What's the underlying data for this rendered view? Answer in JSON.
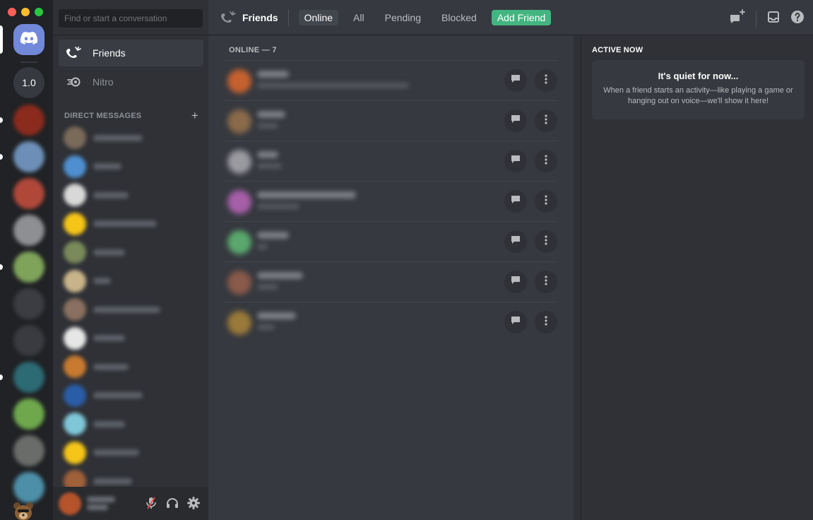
{
  "window": {
    "controls": [
      {
        "name": "close",
        "color": "#ff5f57"
      },
      {
        "name": "minimize",
        "color": "#febc2e"
      },
      {
        "name": "zoom",
        "color": "#28c840"
      }
    ]
  },
  "rail": {
    "home_icon": "discord-logo-icon",
    "version_label": "1.0",
    "servers": [
      {
        "color": "#8a2b1e",
        "unread": true
      },
      {
        "color": "#6d8fb7",
        "unread": true
      },
      {
        "color": "#b0483a",
        "unread": false
      },
      {
        "color": "#8d8f92",
        "unread": false
      },
      {
        "color": "#7fa35a",
        "unread": true
      },
      {
        "color": "#3b3d42",
        "unread": false
      },
      {
        "color": "#393b40",
        "unread": false
      },
      {
        "color": "#2c6a74",
        "unread": true
      },
      {
        "color": "#6fa84c",
        "unread": false
      },
      {
        "color": "#6a6c6a",
        "unread": false
      },
      {
        "color": "#4d8fa8",
        "unread": false
      }
    ]
  },
  "sidebar": {
    "search_placeholder": "Find or start a conversation",
    "nav": [
      {
        "label": "Friends",
        "icon": "friends-wave-icon",
        "active": true
      },
      {
        "label": "Nitro",
        "icon": "nitro-icon",
        "active": false
      }
    ],
    "dm_header": "DIRECT MESSAGES",
    "dm_add": "+",
    "dms": [
      {
        "color": "#7a6a5a"
      },
      {
        "color": "#4f8fd0"
      },
      {
        "color": "#d8d8d8"
      },
      {
        "color": "#f5c518"
      },
      {
        "color": "#7a8a5a"
      },
      {
        "color": "#c9b48a"
      },
      {
        "color": "#8a7060"
      },
      {
        "color": "#e6e6e6"
      },
      {
        "color": "#c77a30"
      },
      {
        "color": "#2a5da8"
      },
      {
        "color": "#7fc7d8"
      },
      {
        "color": "#f5c518"
      },
      {
        "color": "#a0603a"
      }
    ]
  },
  "user_panel": {
    "controls": [
      "mute-mic-icon",
      "headphones-icon",
      "settings-gear-icon"
    ]
  },
  "header": {
    "title": "Friends",
    "tabs": [
      {
        "label": "Online",
        "active": true
      },
      {
        "label": "All",
        "active": false
      },
      {
        "label": "Pending",
        "active": false
      },
      {
        "label": "Blocked",
        "active": false
      }
    ],
    "add_friend": "Add Friend",
    "right_icons": [
      "new-group-dm-icon",
      "inbox-icon",
      "help-icon"
    ]
  },
  "friends": {
    "section_label": "ONLINE — 7",
    "rows": [
      {
        "color": "#c5612f"
      },
      {
        "color": "#8a6a4a"
      },
      {
        "color": "#9a9aa0"
      },
      {
        "color": "#a65fa8"
      },
      {
        "color": "#5aa86e"
      },
      {
        "color": "#8a5a4a"
      },
      {
        "color": "#9a7a3a"
      }
    ],
    "row_actions": [
      "message-icon",
      "more-options-icon"
    ]
  },
  "active_now": {
    "title": "ACTIVE NOW",
    "empty_heading": "It's quiet for now...",
    "empty_body": "When a friend starts an activity—like playing a game or hanging out on voice—we'll show it here!"
  }
}
